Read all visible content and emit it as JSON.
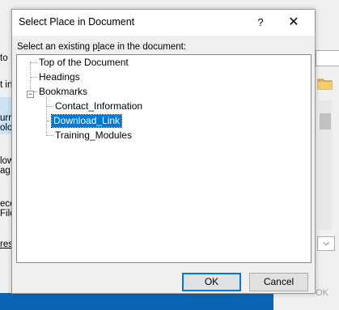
{
  "dialog": {
    "title": "Select Place in Document",
    "help_label": "?",
    "close_label": "✕",
    "prompt": "Select an existing place in the document:",
    "tree": {
      "top": "Top of the Document",
      "headings": "Headings",
      "bookmarks": "Bookmarks",
      "bookmark_items": [
        "Contact_Information",
        "Download_Link",
        "Training_Modules"
      ],
      "expander_symbol": "−",
      "selected": "Download_Link"
    },
    "ok_label": "OK",
    "cancel_label": "Cancel"
  },
  "background": {
    "fragments": [
      "to",
      "t in",
      "urr",
      "olo",
      "low",
      "ag",
      "ece",
      "File",
      "res"
    ],
    "dropdown_glyph": "⌵",
    "ok_fragment": "OK"
  },
  "colors": {
    "selection": "#0078d7",
    "taskbar": "#0b63b5"
  }
}
